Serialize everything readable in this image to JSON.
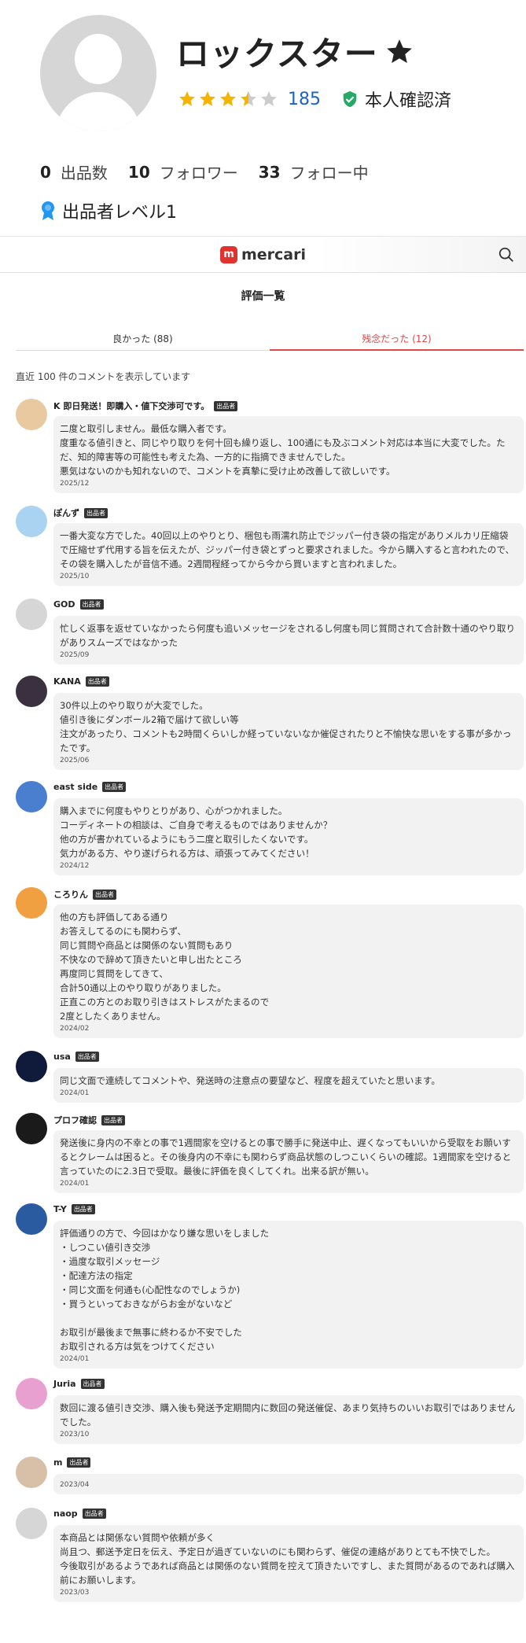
{
  "profile": {
    "name": "ロックスター",
    "rating_stars": 3.5,
    "review_count": "185",
    "verified_label": "本人確認済",
    "stats": [
      {
        "num": "0",
        "label": "出品数"
      },
      {
        "num": "10",
        "label": "フォロワー"
      },
      {
        "num": "33",
        "label": "フォロー中"
      }
    ],
    "level_label": "出品者レベル1"
  },
  "header": {
    "logo_text": "mercari",
    "logo_mark": "m"
  },
  "page": {
    "title": "評価一覧",
    "note": "直近 100 件のコメントを表示しています"
  },
  "tabs": [
    {
      "label": "良かった (88)"
    },
    {
      "label": "残念だった (12)"
    }
  ],
  "reviews": [
    {
      "name": "K 即日発送！即購入・値下交渉可です。",
      "badge": "出品者",
      "text": "二度と取引しません。最低な購入者です。\n度重なる値引きと、同じやり取りを何十回も繰り返し、100通にも及ぶコメント対応は本当に大変でした。ただ、知的障害等の可能性も考えた為、一方的に指摘できませんでした。\n悪気はないのかも知れないので、コメントを真摯に受け止め改善して欲しいです。",
      "date": "2025/12"
    },
    {
      "name": "ぽんず",
      "badge": "出品者",
      "text": "一番大変な方でした。40回以上のやりとり、梱包も雨濡れ防止でジッパー付き袋の指定がありメルカリ圧縮袋で圧縮せず代用する旨を伝えたが、ジッパー付き袋とずっと要求されました。今から購入すると言われたので、その袋を購入したが音信不通。2週間程経ってから今から買いますと言われました。",
      "date": "2025/10"
    },
    {
      "name": "GOD",
      "badge": "出品者",
      "text": "忙しく返事を返せていなかったら何度も追いメッセージをされるし何度も同じ質問されて合計数十通のやり取りがありスムーズではなかった",
      "date": "2025/09"
    },
    {
      "name": "KANA",
      "badge": "出品者",
      "text": "30件以上のやり取りが大変でした。\n値引き後にダンボール2箱で届けて欲しい等\n注文があったり、コメントも2時間くらいしか経っていないなか催促されたりと不愉快な思いをする事が多かったです。",
      "date": "2025/06"
    },
    {
      "name": "east side",
      "badge": "出品者",
      "text": "購入までに何度もやりとりがあり、心がつかれました。\nコーディネートの相談は、ご自身で考えるものではありませんか？\n他の方が書かれているようにもう二度と取引したくないです。\n気力がある方、やり遂げられる方は、頑張ってみてください！",
      "date": "2024/12"
    },
    {
      "name": "ころりん",
      "badge": "出品者",
      "text": "他の方も評価してある通り\nお答えしてるのにも関わらず、\n同じ質問や商品とは関係のない質問もあり\n不快なので辞めて頂きたいと申し出たところ\n再度同じ質問をしてきて、\n合計50通以上のやり取りがありました。\n正直この方とのお取り引きはストレスがたまるので\n2度としたくありません。",
      "date": "2024/02"
    },
    {
      "name": "usa",
      "badge": "出品者",
      "text": "同じ文面で連続してコメントや、発送時の注意点の要望など、程度を超えていたと思います。",
      "date": "2024/01"
    },
    {
      "name": "プロフ確認",
      "badge": "出品者",
      "text": "発送後に身内の不幸との事で1週間家を空けるとの事で勝手に発送中止、遅くなってもいいから受取をお願いするとクレームは困ると。その後身内の不幸にも関わらず商品状態のしつこいくらいの確認。1週間家を空けると言っていたのに2.3日で受取。最後に評価を良くしてくれ。出来る訳が無い。",
      "date": "2024/01"
    },
    {
      "name": "T-Y",
      "badge": "出品者",
      "text": "評価通りの方で、今回はかなり嫌な思いをしました\n・しつこい値引き交渉\n・過度な取引メッセージ\n・配達方法の指定\n・同じ文面を何通も(心配性なのでしょうか)\n・買うといっておきながらお金がないなど\n\nお取引が最後まで無事に終わるか不安でした\nお取引される方は気をつけてください",
      "date": "2024/01"
    },
    {
      "name": "Juria",
      "badge": "出品者",
      "text": "数回に渡る値引き交渉、購入後も発送予定期間内に数回の発送催促、あまり気持ちのいいお取引ではありませんでした。",
      "date": "2023/10"
    },
    {
      "name": "m",
      "badge": "出品者",
      "text": "",
      "date": "2023/04"
    },
    {
      "name": "naop",
      "badge": "出品者",
      "text": "本商品とは関係ない質問や依頼が多く\n尚且つ、郵送予定日を伝え、予定日が過ぎていないのにも関わらず、催促の連絡がありとても不快でした。\n今後取引があるようであれば商品とは関係のない質問を控えて頂きたいですし、また質問があるのであれば購入前にお願いします。",
      "date": "2023/03"
    }
  ],
  "colors": {
    "accent_red": "#e04646",
    "star": "#f5b400",
    "link_blue": "#1b63c5",
    "verified_green": "#27a865"
  }
}
